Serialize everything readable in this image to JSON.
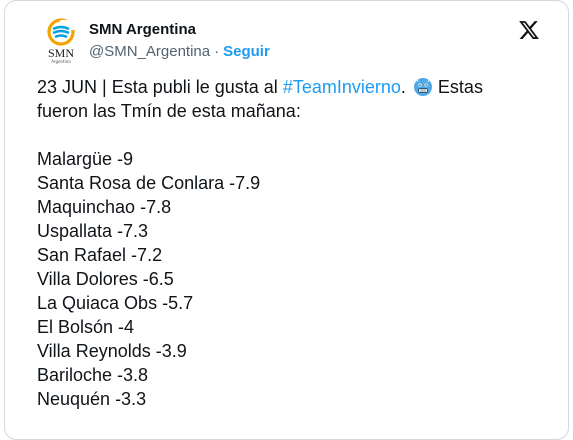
{
  "account": {
    "display_name": "SMN Argentina",
    "handle": "@SMN_Argentina",
    "separator": "·",
    "follow_label": "Seguir",
    "avatar_text": "SMN",
    "avatar_subtext": "Argentina"
  },
  "tweet": {
    "intro_prefix": "23 JUN | Esta publi le gusta al ",
    "hashtag": "#TeamInvierno",
    "intro_after_hashtag": ".",
    "intro_after_emoji": " Estas",
    "intro_line2": "fueron las Tmín de esta mañana:",
    "emoji": "cold-face-emoji",
    "temperatures": [
      "Malargüe -9",
      "Santa Rosa de Conlara -7.9",
      "Maquinchao -7.8",
      "Uspallata -7.3",
      "San Rafael -7.2",
      "Villa Dolores -6.5",
      "La Quiaca Obs -5.7",
      "El Bolsón -4",
      "Villa Reynolds -3.9",
      "Bariloche -3.8",
      "Neuquén -3.3"
    ]
  },
  "icons": {
    "x_logo": "x-logo-icon",
    "avatar_logo": "smn-logo-icon"
  },
  "colors": {
    "link": "#1d9bf0",
    "text": "#0f1419",
    "secondary_text": "#536471",
    "border": "#cfd9de"
  }
}
